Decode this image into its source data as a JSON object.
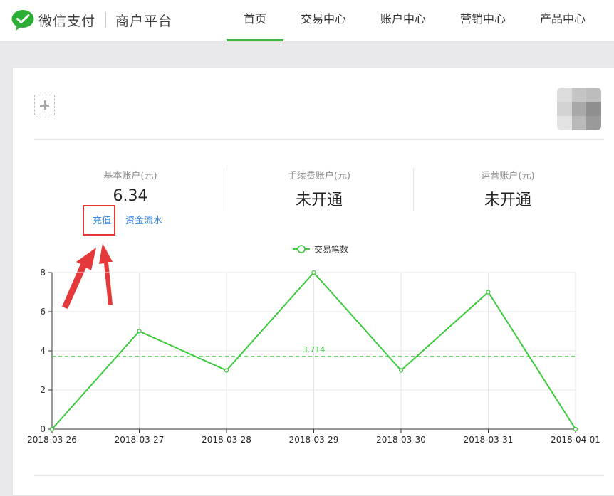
{
  "header": {
    "logo_text": "微信支付",
    "logo_subtitle": "商户平台",
    "nav": [
      "首页",
      "交易中心",
      "账户中心",
      "营销中心",
      "产品中心"
    ],
    "active_nav": "首页"
  },
  "accounts": [
    {
      "label": "基本账户(元)",
      "value": "6.34"
    },
    {
      "label": "手续费账户(元)",
      "value": "未开通"
    },
    {
      "label": "运营账户(元)",
      "value": "未开通"
    }
  ],
  "actions": {
    "recharge": "充值",
    "fund_flow": "资金流水"
  },
  "colors": {
    "brand_green": "#44b549",
    "series_green": "#3cc93c",
    "link_blue": "#3a8ee6",
    "annotation_red": "#e5383b"
  },
  "chart_data": {
    "type": "line",
    "legend": [
      "交易笔数"
    ],
    "legend_position": "top-center",
    "categories": [
      "2018-03-26",
      "2018-03-27",
      "2018-03-28",
      "2018-03-29",
      "2018-03-30",
      "2018-03-31",
      "2018-04-01"
    ],
    "series": [
      {
        "name": "交易笔数",
        "values": [
          0,
          5,
          3,
          8,
          3,
          7,
          0
        ]
      }
    ],
    "average_line": {
      "value": 3.714,
      "label": "3.714"
    },
    "ylim": [
      0,
      8
    ],
    "yticks": [
      0,
      2,
      4,
      6,
      8
    ],
    "grid": true
  }
}
